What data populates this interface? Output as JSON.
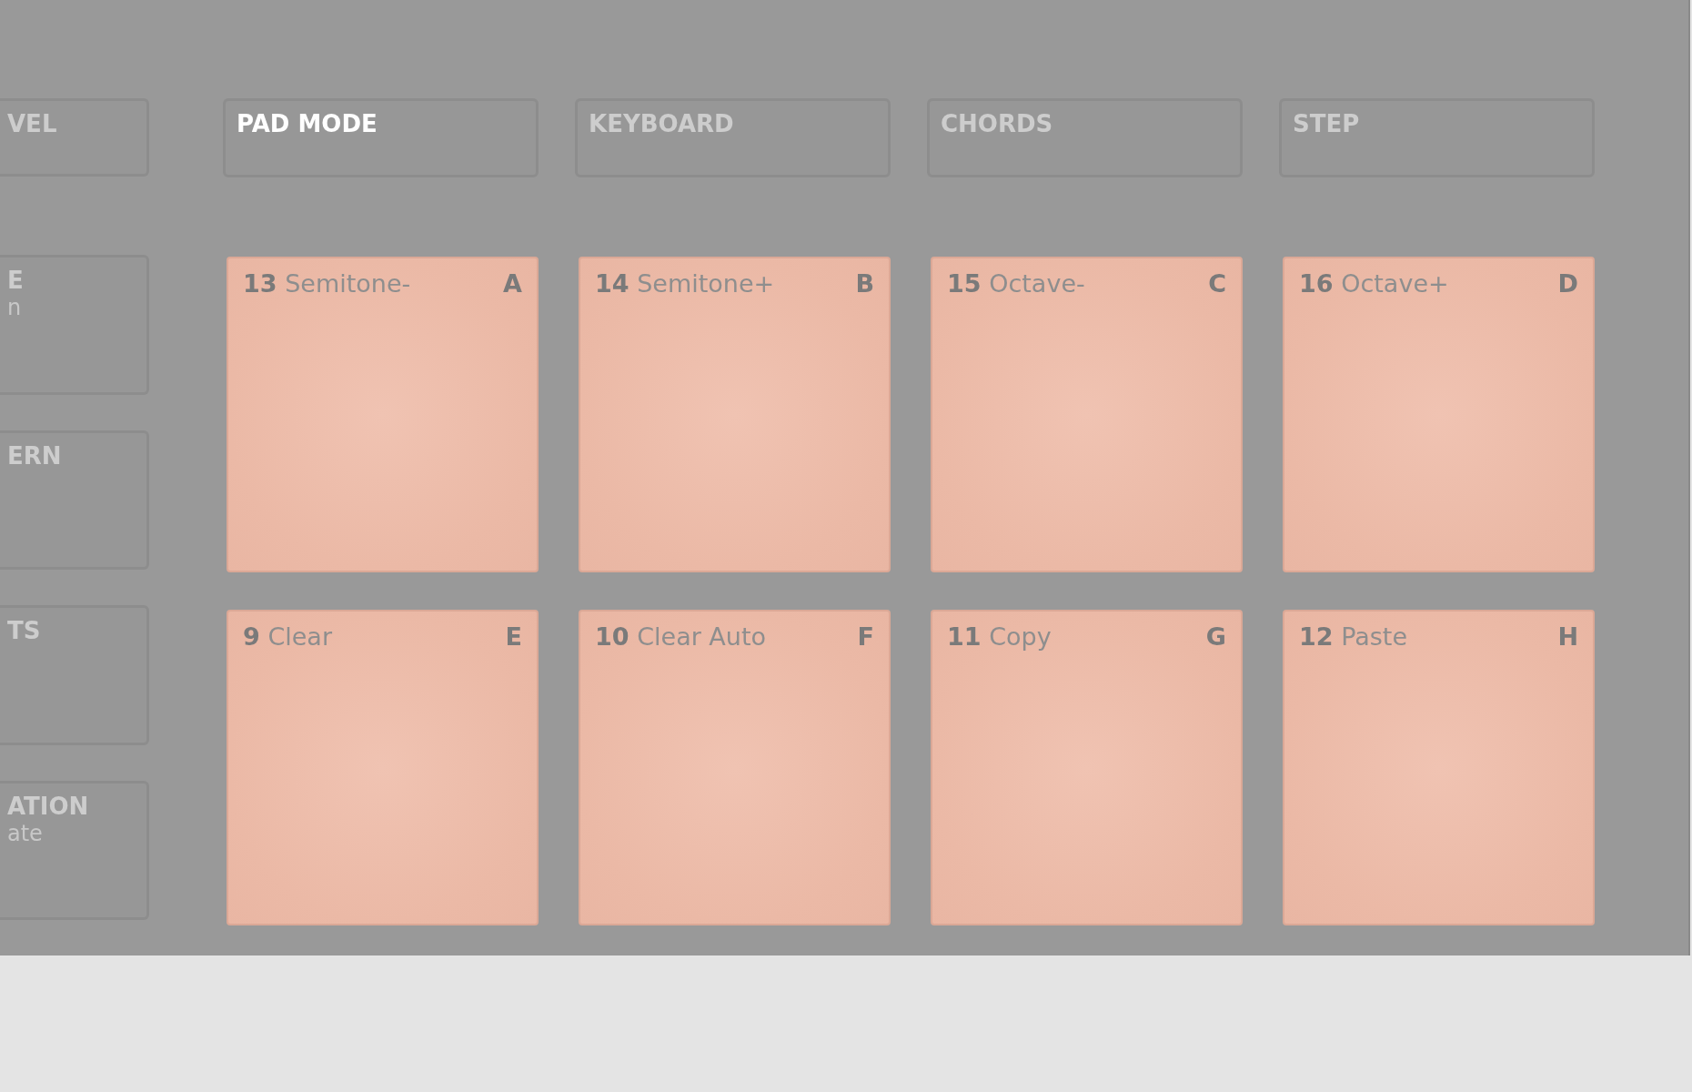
{
  "side_buttons": [
    {
      "label": "VEL"
    },
    {
      "label": "E",
      "sublabel": "n"
    },
    {
      "label": "ERN"
    },
    {
      "label": "TS"
    },
    {
      "label": "ATION",
      "sublabel": "ate"
    }
  ],
  "modes": [
    {
      "label": "PAD MODE",
      "selected": true
    },
    {
      "label": "KEYBOARD",
      "selected": false
    },
    {
      "label": "CHORDS",
      "selected": false
    },
    {
      "label": "STEP",
      "selected": false
    }
  ],
  "pads": [
    {
      "number": "13",
      "name": "Semitone-",
      "letter": "A"
    },
    {
      "number": "14",
      "name": "Semitone+",
      "letter": "B"
    },
    {
      "number": "15",
      "name": "Octave-",
      "letter": "C"
    },
    {
      "number": "16",
      "name": "Octave+",
      "letter": "D"
    },
    {
      "number": "9",
      "name": "Clear",
      "letter": "E"
    },
    {
      "number": "10",
      "name": "Clear Auto",
      "letter": "F"
    },
    {
      "number": "11",
      "name": "Copy",
      "letter": "G"
    },
    {
      "number": "12",
      "name": "Paste",
      "letter": "H"
    }
  ]
}
